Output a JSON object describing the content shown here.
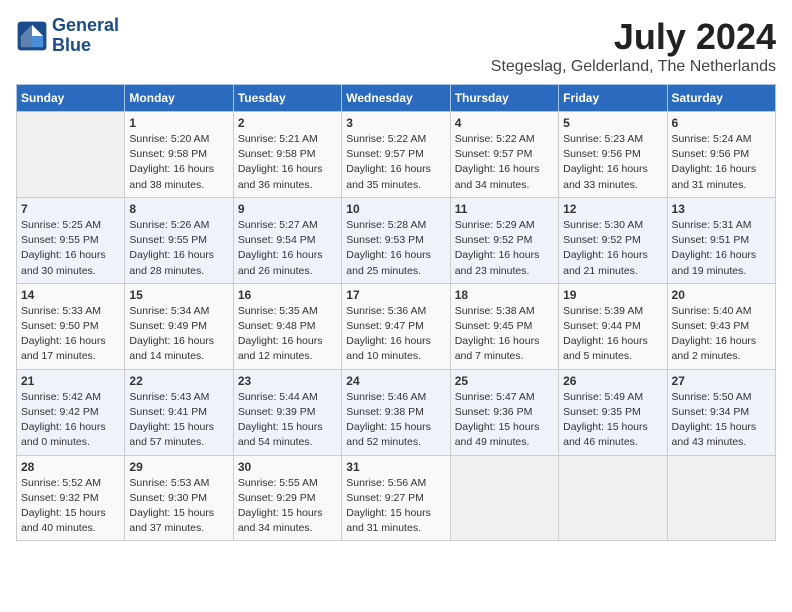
{
  "logo": {
    "line1": "General",
    "line2": "Blue"
  },
  "title": "July 2024",
  "subtitle": "Stegeslag, Gelderland, The Netherlands",
  "days_of_week": [
    "Sunday",
    "Monday",
    "Tuesday",
    "Wednesday",
    "Thursday",
    "Friday",
    "Saturday"
  ],
  "weeks": [
    [
      {
        "num": "",
        "info": ""
      },
      {
        "num": "1",
        "info": "Sunrise: 5:20 AM\nSunset: 9:58 PM\nDaylight: 16 hours\nand 38 minutes."
      },
      {
        "num": "2",
        "info": "Sunrise: 5:21 AM\nSunset: 9:58 PM\nDaylight: 16 hours\nand 36 minutes."
      },
      {
        "num": "3",
        "info": "Sunrise: 5:22 AM\nSunset: 9:57 PM\nDaylight: 16 hours\nand 35 minutes."
      },
      {
        "num": "4",
        "info": "Sunrise: 5:22 AM\nSunset: 9:57 PM\nDaylight: 16 hours\nand 34 minutes."
      },
      {
        "num": "5",
        "info": "Sunrise: 5:23 AM\nSunset: 9:56 PM\nDaylight: 16 hours\nand 33 minutes."
      },
      {
        "num": "6",
        "info": "Sunrise: 5:24 AM\nSunset: 9:56 PM\nDaylight: 16 hours\nand 31 minutes."
      }
    ],
    [
      {
        "num": "7",
        "info": "Sunrise: 5:25 AM\nSunset: 9:55 PM\nDaylight: 16 hours\nand 30 minutes."
      },
      {
        "num": "8",
        "info": "Sunrise: 5:26 AM\nSunset: 9:55 PM\nDaylight: 16 hours\nand 28 minutes."
      },
      {
        "num": "9",
        "info": "Sunrise: 5:27 AM\nSunset: 9:54 PM\nDaylight: 16 hours\nand 26 minutes."
      },
      {
        "num": "10",
        "info": "Sunrise: 5:28 AM\nSunset: 9:53 PM\nDaylight: 16 hours\nand 25 minutes."
      },
      {
        "num": "11",
        "info": "Sunrise: 5:29 AM\nSunset: 9:52 PM\nDaylight: 16 hours\nand 23 minutes."
      },
      {
        "num": "12",
        "info": "Sunrise: 5:30 AM\nSunset: 9:52 PM\nDaylight: 16 hours\nand 21 minutes."
      },
      {
        "num": "13",
        "info": "Sunrise: 5:31 AM\nSunset: 9:51 PM\nDaylight: 16 hours\nand 19 minutes."
      }
    ],
    [
      {
        "num": "14",
        "info": "Sunrise: 5:33 AM\nSunset: 9:50 PM\nDaylight: 16 hours\nand 17 minutes."
      },
      {
        "num": "15",
        "info": "Sunrise: 5:34 AM\nSunset: 9:49 PM\nDaylight: 16 hours\nand 14 minutes."
      },
      {
        "num": "16",
        "info": "Sunrise: 5:35 AM\nSunset: 9:48 PM\nDaylight: 16 hours\nand 12 minutes."
      },
      {
        "num": "17",
        "info": "Sunrise: 5:36 AM\nSunset: 9:47 PM\nDaylight: 16 hours\nand 10 minutes."
      },
      {
        "num": "18",
        "info": "Sunrise: 5:38 AM\nSunset: 9:45 PM\nDaylight: 16 hours\nand 7 minutes."
      },
      {
        "num": "19",
        "info": "Sunrise: 5:39 AM\nSunset: 9:44 PM\nDaylight: 16 hours\nand 5 minutes."
      },
      {
        "num": "20",
        "info": "Sunrise: 5:40 AM\nSunset: 9:43 PM\nDaylight: 16 hours\nand 2 minutes."
      }
    ],
    [
      {
        "num": "21",
        "info": "Sunrise: 5:42 AM\nSunset: 9:42 PM\nDaylight: 16 hours\nand 0 minutes."
      },
      {
        "num": "22",
        "info": "Sunrise: 5:43 AM\nSunset: 9:41 PM\nDaylight: 15 hours\nand 57 minutes."
      },
      {
        "num": "23",
        "info": "Sunrise: 5:44 AM\nSunset: 9:39 PM\nDaylight: 15 hours\nand 54 minutes."
      },
      {
        "num": "24",
        "info": "Sunrise: 5:46 AM\nSunset: 9:38 PM\nDaylight: 15 hours\nand 52 minutes."
      },
      {
        "num": "25",
        "info": "Sunrise: 5:47 AM\nSunset: 9:36 PM\nDaylight: 15 hours\nand 49 minutes."
      },
      {
        "num": "26",
        "info": "Sunrise: 5:49 AM\nSunset: 9:35 PM\nDaylight: 15 hours\nand 46 minutes."
      },
      {
        "num": "27",
        "info": "Sunrise: 5:50 AM\nSunset: 9:34 PM\nDaylight: 15 hours\nand 43 minutes."
      }
    ],
    [
      {
        "num": "28",
        "info": "Sunrise: 5:52 AM\nSunset: 9:32 PM\nDaylight: 15 hours\nand 40 minutes."
      },
      {
        "num": "29",
        "info": "Sunrise: 5:53 AM\nSunset: 9:30 PM\nDaylight: 15 hours\nand 37 minutes."
      },
      {
        "num": "30",
        "info": "Sunrise: 5:55 AM\nSunset: 9:29 PM\nDaylight: 15 hours\nand 34 minutes."
      },
      {
        "num": "31",
        "info": "Sunrise: 5:56 AM\nSunset: 9:27 PM\nDaylight: 15 hours\nand 31 minutes."
      },
      {
        "num": "",
        "info": ""
      },
      {
        "num": "",
        "info": ""
      },
      {
        "num": "",
        "info": ""
      }
    ]
  ]
}
